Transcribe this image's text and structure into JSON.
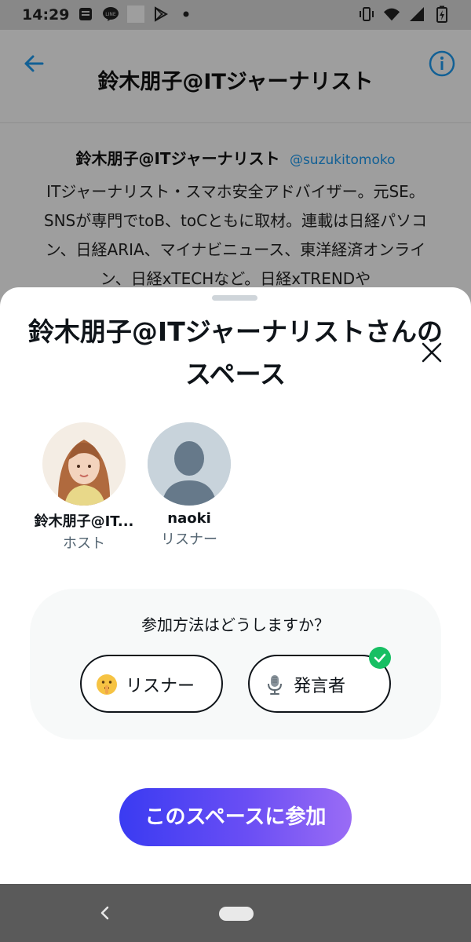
{
  "status_bar": {
    "time": "14:29",
    "left_icons": [
      "message-icon",
      "line-app-icon",
      "square-icon",
      "play-store-icon",
      "dot-icon"
    ],
    "right_icons": [
      "vibrate-icon",
      "wifi-icon",
      "signal-icon",
      "battery-charging-icon"
    ]
  },
  "header": {
    "title": "鈴木朋子@ITジャーナリスト",
    "back_icon": "back-arrow-icon",
    "info_icon": "info-icon",
    "accent_color": "#1d9bf0"
  },
  "profile": {
    "name": "鈴木朋子@ITジャーナリスト",
    "handle": "@suzukitomoko",
    "bio": "ITジャーナリスト・スマホ安全アドバイザー。元SE。SNSが専門でtoB、toCともに取材。連載は日経パソコン、日経ARIA、マイナビニュース、東洋経済オンライン、日経xTECHなど。日経xTRENDや"
  },
  "sheet": {
    "title": "鈴木朋子@ITジャーナリストさんのスペース",
    "participants": [
      {
        "name": "鈴木朋子@IT...",
        "role": "ホスト",
        "avatar": "host-photo"
      },
      {
        "name": "naoki",
        "role": "リスナー",
        "avatar": "default-avatar"
      }
    ],
    "join_question": "参加方法はどうしますか？",
    "options": [
      {
        "label": "リスナー",
        "icon": "shushing-face-icon",
        "selected": false
      },
      {
        "label": "発言者",
        "icon": "microphone-icon",
        "selected": true
      }
    ],
    "join_button": "このスペースに参加",
    "colors": {
      "join_gradient_start": "#3a3bf2",
      "join_gradient_end": "#9a6cf5",
      "selected_badge": "#17bf63"
    }
  },
  "nav_bar": {
    "back_icon": "nav-back-icon",
    "home_icon": "nav-home-pill"
  }
}
